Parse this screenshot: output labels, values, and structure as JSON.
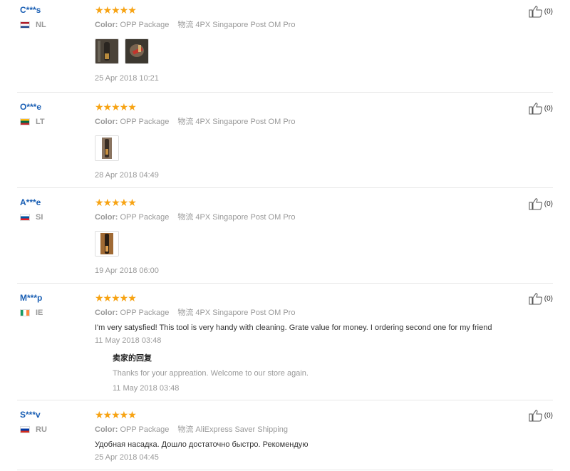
{
  "reviews": [
    {
      "user": "C***s",
      "country": "NL",
      "stars": "★★★★★",
      "color_label": "Color:",
      "color_value": "OPP Package",
      "ship_label": "物流",
      "ship_value": "4PX Singapore Post OM Pro",
      "date": "25 Apr 2018 10:21",
      "likes": "(0)"
    },
    {
      "user": "O***e",
      "country": "LT",
      "stars": "★★★★★",
      "color_label": "Color:",
      "color_value": "OPP Package",
      "ship_label": "物流",
      "ship_value": "4PX Singapore Post OM Pro",
      "date": "28 Apr 2018 04:49",
      "likes": "(0)"
    },
    {
      "user": "A***e",
      "country": "SI",
      "stars": "★★★★★",
      "color_label": "Color:",
      "color_value": "OPP Package",
      "ship_label": "物流",
      "ship_value": "4PX Singapore Post OM Pro",
      "date": "19 Apr 2018 06:00",
      "likes": "(0)"
    },
    {
      "user": "M***p",
      "country": "IE",
      "stars": "★★★★★",
      "color_label": "Color:",
      "color_value": "OPP Package",
      "ship_label": "物流",
      "ship_value": "4PX Singapore Post OM Pro",
      "comment": "I'm very satysfied! This tool is very handy with cleaning. Grate value for money. I ordering second one for my friend",
      "date": "11 May 2018 03:48",
      "reply_title": "卖家的回复",
      "reply_text": "Thanks for your appreation. Welcome to our store again.",
      "reply_date": "11 May 2018 03:48",
      "likes": "(0)"
    },
    {
      "user": "S***v",
      "country": "RU",
      "stars": "★★★★★",
      "color_label": "Color:",
      "color_value": "OPP Package",
      "ship_label": "物流",
      "ship_value": "AliExpress Saver Shipping",
      "comment": "Удобная насадка. Дошло достаточно быстро. Рекомендую",
      "date": "25 Apr 2018 04:45",
      "likes": "(0)"
    }
  ],
  "colors": {
    "star": "#f7a313",
    "username": "#1a5fb4",
    "muted": "#999999"
  }
}
